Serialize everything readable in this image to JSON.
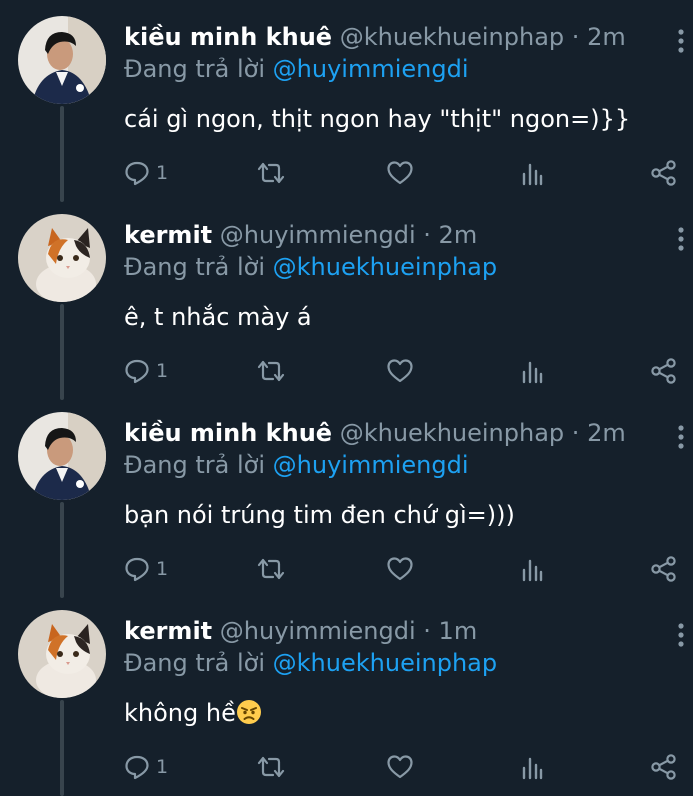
{
  "tweets": [
    {
      "display_name": "kiều minh khuê",
      "handle": "@khuekhueinphap",
      "separator": "·",
      "time": "2m",
      "reply_prefix": "Đang trả lời",
      "reply_to": "@huyimmiengdi",
      "text": "cái gì ngon, thịt ngon hay \"thịt\" ngon=)}}",
      "reply_count": "1",
      "avatar": "person-avatar"
    },
    {
      "display_name": "kermit",
      "handle": "@huyimmiengdi",
      "separator": "·",
      "time": "2m",
      "reply_prefix": "Đang trả lời",
      "reply_to": "@khuekhueinphap",
      "text": "ê, t nhắc mày á",
      "reply_count": "1",
      "avatar": "cat-avatar"
    },
    {
      "display_name": "kiều minh khuê",
      "handle": "@khuekhueinphap",
      "separator": "·",
      "time": "2m",
      "reply_prefix": "Đang trả lời",
      "reply_to": "@huyimmiengdi",
      "text": "bạn nói trúng tim đen chứ gì=)))",
      "reply_count": "1",
      "avatar": "person-avatar"
    },
    {
      "display_name": "kermit",
      "handle": "@huyimmiengdi",
      "separator": "·",
      "time": "1m",
      "reply_prefix": "Đang trả lời",
      "reply_to": "@khuekhueinphap",
      "text": "không hề",
      "reply_count": "1",
      "avatar": "cat-avatar",
      "emoji": "angry-face-emoji"
    }
  ],
  "colors": {
    "background": "#15202b",
    "text": "#ffffff",
    "muted": "#8899a6",
    "accent": "#1da1f2",
    "connector": "#38444d"
  },
  "icons": [
    "reply-icon",
    "retweet-icon",
    "like-icon",
    "analytics-icon",
    "share-icon",
    "more-options-icon"
  ]
}
